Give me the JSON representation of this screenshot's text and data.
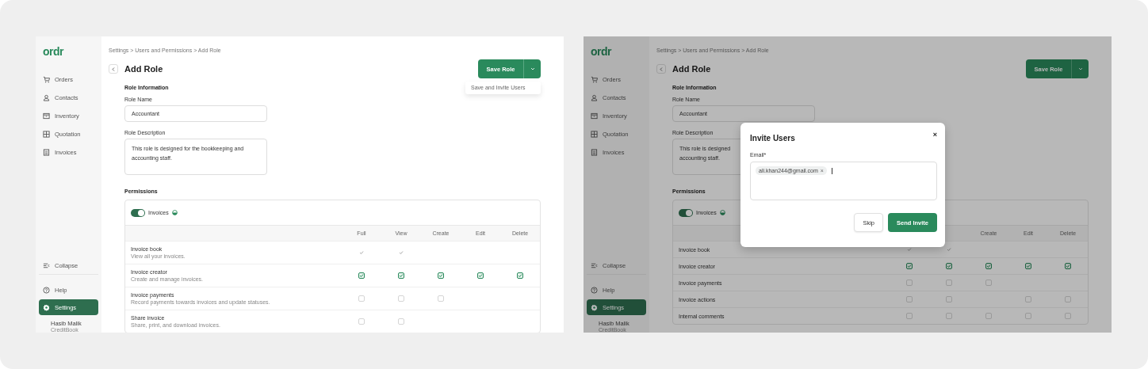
{
  "screens": [
    {
      "sidebar": {
        "logo": "ordr",
        "items": [
          {
            "label": "Orders",
            "selected": false
          },
          {
            "label": "Contacts",
            "selected": false
          },
          {
            "label": "Inventory",
            "selected": false
          },
          {
            "label": "Quotation",
            "selected": false
          },
          {
            "label": "Invoices",
            "selected": false
          }
        ],
        "collapse": "Collapse",
        "bottom_items": [
          {
            "label": "Help",
            "selected": false
          },
          {
            "label": "Settings",
            "selected": true
          }
        ],
        "user": {
          "name": "Hasib Malik",
          "company": "CreditBook"
        }
      },
      "breadcrumb": "Settings > Users and Permissions > Add Role",
      "title": "Add Role",
      "save_button": "Save Role",
      "menu": {
        "items": [
          "Save and Invite Users"
        ]
      },
      "role_information": {
        "heading": "Role Information",
        "name_label": "Role Name",
        "name_value": "Accountant",
        "description_label": "Role Description",
        "description_value": "This role is designed for the bookkeeping and accounting staff."
      },
      "permissions": {
        "heading": "Permissions",
        "module": {
          "label": "Invoices",
          "on": true
        },
        "columns": [
          "Full",
          "View",
          "Create",
          "Edit",
          "Delete"
        ],
        "rows": [
          {
            "name": "Invoice book",
            "description": "View all your invoices.",
            "cells": [
              {
                "kind": "checkbox",
                "checked": true,
                "disabled": true
              },
              {
                "kind": "checkbox",
                "checked": true,
                "disabled": true
              },
              {
                "kind": "none"
              },
              {
                "kind": "none"
              },
              {
                "kind": "none"
              }
            ]
          },
          {
            "name": "Invoice creator",
            "description": "Create and manage invoices.",
            "cells": [
              {
                "kind": "checkbox",
                "checked": true,
                "disabled": false
              },
              {
                "kind": "checkbox",
                "checked": true,
                "disabled": false
              },
              {
                "kind": "checkbox",
                "checked": true,
                "disabled": false
              },
              {
                "kind": "checkbox",
                "checked": true,
                "disabled": false
              },
              {
                "kind": "checkbox",
                "checked": true,
                "disabled": false
              }
            ]
          },
          {
            "name": "Invoice payments",
            "description": "Record payments towards invoices and update statuses.",
            "cells": [
              {
                "kind": "checkbox",
                "checked": false,
                "disabled": false
              },
              {
                "kind": "checkbox",
                "checked": false,
                "disabled": false
              },
              {
                "kind": "checkbox",
                "checked": false,
                "disabled": false
              },
              {
                "kind": "none"
              },
              {
                "kind": "none"
              }
            ]
          },
          {
            "name": "Share invoice",
            "description": "Share, print, and download invoices.",
            "cells": [
              {
                "kind": "checkbox",
                "checked": false,
                "disabled": false
              },
              {
                "kind": "checkbox",
                "checked": false,
                "disabled": false
              },
              {
                "kind": "none"
              },
              {
                "kind": "none"
              },
              {
                "kind": "none"
              }
            ]
          }
        ]
      }
    },
    {
      "sidebar": {
        "logo": "ordr",
        "items": [
          {
            "label": "Orders",
            "selected": false
          },
          {
            "label": "Contacts",
            "selected": false
          },
          {
            "label": "Inventory",
            "selected": false
          },
          {
            "label": "Quotation",
            "selected": false
          },
          {
            "label": "Invoices",
            "selected": false
          }
        ],
        "collapse": "Collapse",
        "bottom_items": [
          {
            "label": "Help",
            "selected": false
          },
          {
            "label": "Settings",
            "selected": true
          }
        ],
        "user": {
          "name": "Hasib Malik",
          "company": "CreditBook"
        }
      },
      "breadcrumb": "Settings > Users and Permissions > Add Role",
      "title": "Add Role",
      "save_button": "Save Role",
      "role_information": {
        "heading": "Role Information",
        "name_label": "Role Name",
        "name_value": "Accountant",
        "description_label": "Role Description",
        "description_lines": [
          "This role is designed",
          "accounting staff."
        ]
      },
      "permissions": {
        "heading": "Permissions",
        "module": {
          "label": "Invoices",
          "on": true
        },
        "columns": [
          "Create",
          "Edit",
          "Delete"
        ],
        "rows": [
          {
            "name": "Invoice book",
            "cells": [
              {
                "kind": "checkbox",
                "checked": true,
                "disabled": true
              },
              {
                "kind": "checkbox",
                "checked": true,
                "disabled": true
              },
              {
                "kind": "none"
              },
              {
                "kind": "none"
              },
              {
                "kind": "none"
              }
            ]
          },
          {
            "name": "Invoice creator",
            "cells": [
              {
                "kind": "checkbox",
                "checked": true,
                "disabled": false
              },
              {
                "kind": "checkbox",
                "checked": true,
                "disabled": false
              },
              {
                "kind": "checkbox",
                "checked": true,
                "disabled": false
              },
              {
                "kind": "checkbox",
                "checked": true,
                "disabled": false
              },
              {
                "kind": "checkbox",
                "checked": true,
                "disabled": false
              }
            ]
          },
          {
            "name": "Invoice payments",
            "cells": [
              {
                "kind": "checkbox",
                "checked": false,
                "disabled": false
              },
              {
                "kind": "checkbox",
                "checked": false,
                "disabled": false
              },
              {
                "kind": "checkbox",
                "checked": false,
                "disabled": false
              },
              {
                "kind": "none"
              },
              {
                "kind": "none"
              }
            ]
          },
          {
            "name": "Invoice actions",
            "cells": [
              {
                "kind": "checkbox",
                "checked": false,
                "disabled": false
              },
              {
                "kind": "checkbox",
                "checked": false,
                "disabled": false
              },
              {
                "kind": "none"
              },
              {
                "kind": "checkbox",
                "checked": false,
                "disabled": false
              },
              {
                "kind": "checkbox",
                "checked": false,
                "disabled": false
              }
            ]
          },
          {
            "name": "Internal comments",
            "cells": [
              {
                "kind": "checkbox",
                "checked": false,
                "disabled": false
              },
              {
                "kind": "checkbox",
                "checked": false,
                "disabled": false
              },
              {
                "kind": "checkbox",
                "checked": false,
                "disabled": false
              },
              {
                "kind": "checkbox",
                "checked": false,
                "disabled": false
              },
              {
                "kind": "checkbox",
                "checked": false,
                "disabled": false
              }
            ]
          }
        ]
      },
      "dialog": {
        "title": "Invite Users",
        "close": "×",
        "email_label": "Email*",
        "emails": [
          "ali.khan244@gmail.com"
        ],
        "chip_remove": "×",
        "buttons": [
          {
            "label": "Skip",
            "kind": "secondary"
          },
          {
            "label": "Send Invite",
            "kind": "primary"
          }
        ]
      }
    }
  ]
}
